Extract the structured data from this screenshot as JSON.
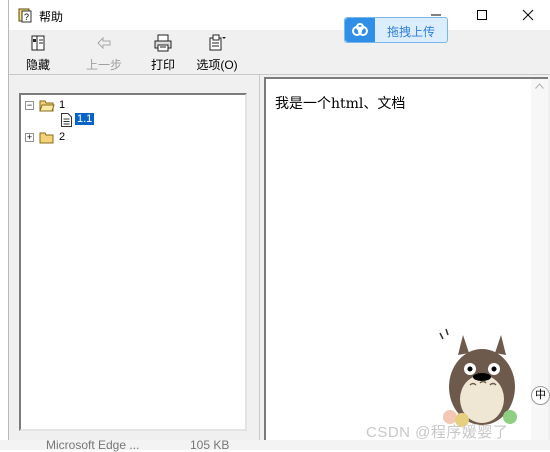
{
  "window": {
    "title": "帮助",
    "icon": "help-book-icon"
  },
  "upload_overlay": {
    "label": "拖拽上传",
    "icon": "baidu-cloud-icon"
  },
  "toolbar": {
    "hide_label": "隐藏",
    "back_label": "上一步",
    "print_label": "打印",
    "options_label": "选项(O)"
  },
  "tree": {
    "nodes": [
      {
        "label": "1",
        "expanded": true,
        "children": [
          {
            "label": "1.1",
            "selected": true
          }
        ]
      },
      {
        "label": "2",
        "expanded": false
      }
    ]
  },
  "content": {
    "text": "我是一个html、文档"
  },
  "background": {
    "taskbar_item_name": "Microsoft Edge ...",
    "taskbar_item_size": "105 KB"
  },
  "watermark": {
    "text": "CSDN @程序媛婴了",
    "badge": "中"
  },
  "colors": {
    "selection": "#0a64c8",
    "upload_accent": "#2f8fe6"
  }
}
